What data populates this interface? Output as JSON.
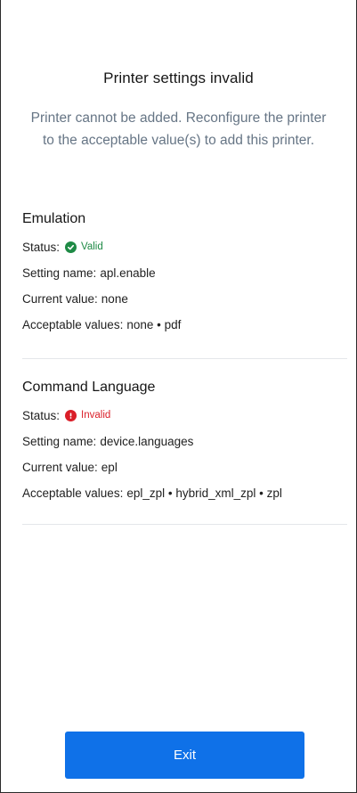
{
  "header": {
    "title": "Printer settings invalid",
    "message": "Printer cannot be added. Reconfigure the printer to the acceptable value(s) to add this printer."
  },
  "sections": [
    {
      "title": "Emulation",
      "status_label": "Status:",
      "status_value": "Valid",
      "status_icon": "check-circle-icon",
      "status_color": "#1e8a45",
      "setting_name_label": "Setting name:",
      "setting_name_value": "apl.enable",
      "current_value_label": "Current value:",
      "current_value_value": "none",
      "acceptable_values_label": "Acceptable values:",
      "acceptable_values_value": "none • pdf"
    },
    {
      "title": "Command Language",
      "status_label": "Status:",
      "status_value": "Invalid",
      "status_icon": "alert-circle-icon",
      "status_color": "#da1e28",
      "setting_name_label": "Setting name:",
      "setting_name_value": "device.languages",
      "current_value_label": "Current value:",
      "current_value_value": "epl",
      "acceptable_values_label": "Acceptable values:",
      "acceptable_values_value": "epl_zpl • hybrid_xml_zpl • zpl"
    }
  ],
  "footer": {
    "exit_label": "Exit"
  },
  "colors": {
    "primary_button": "#0f71e8",
    "valid": "#1e8a45",
    "invalid": "#da1e28",
    "muted_text": "#667585"
  }
}
